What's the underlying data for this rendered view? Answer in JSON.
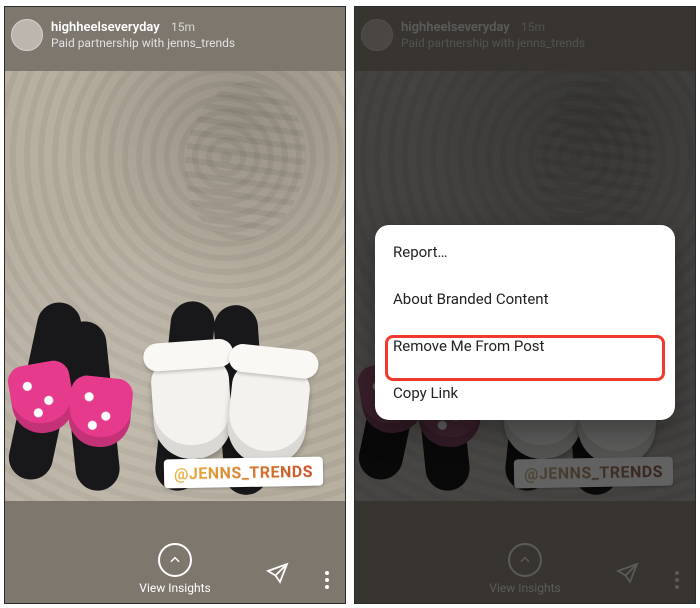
{
  "story": {
    "username": "highheelseveryday",
    "time": "15m",
    "partnership_prefix": "Paid partnership with ",
    "partner": "jenns_trends",
    "mention_tag": "@JENNS_TRENDS",
    "insights_label": "View Insights"
  },
  "menu": {
    "items": [
      "Report…",
      "About Branded Content",
      "Remove Me From Post",
      "Copy Link"
    ],
    "highlighted_index": 2
  }
}
